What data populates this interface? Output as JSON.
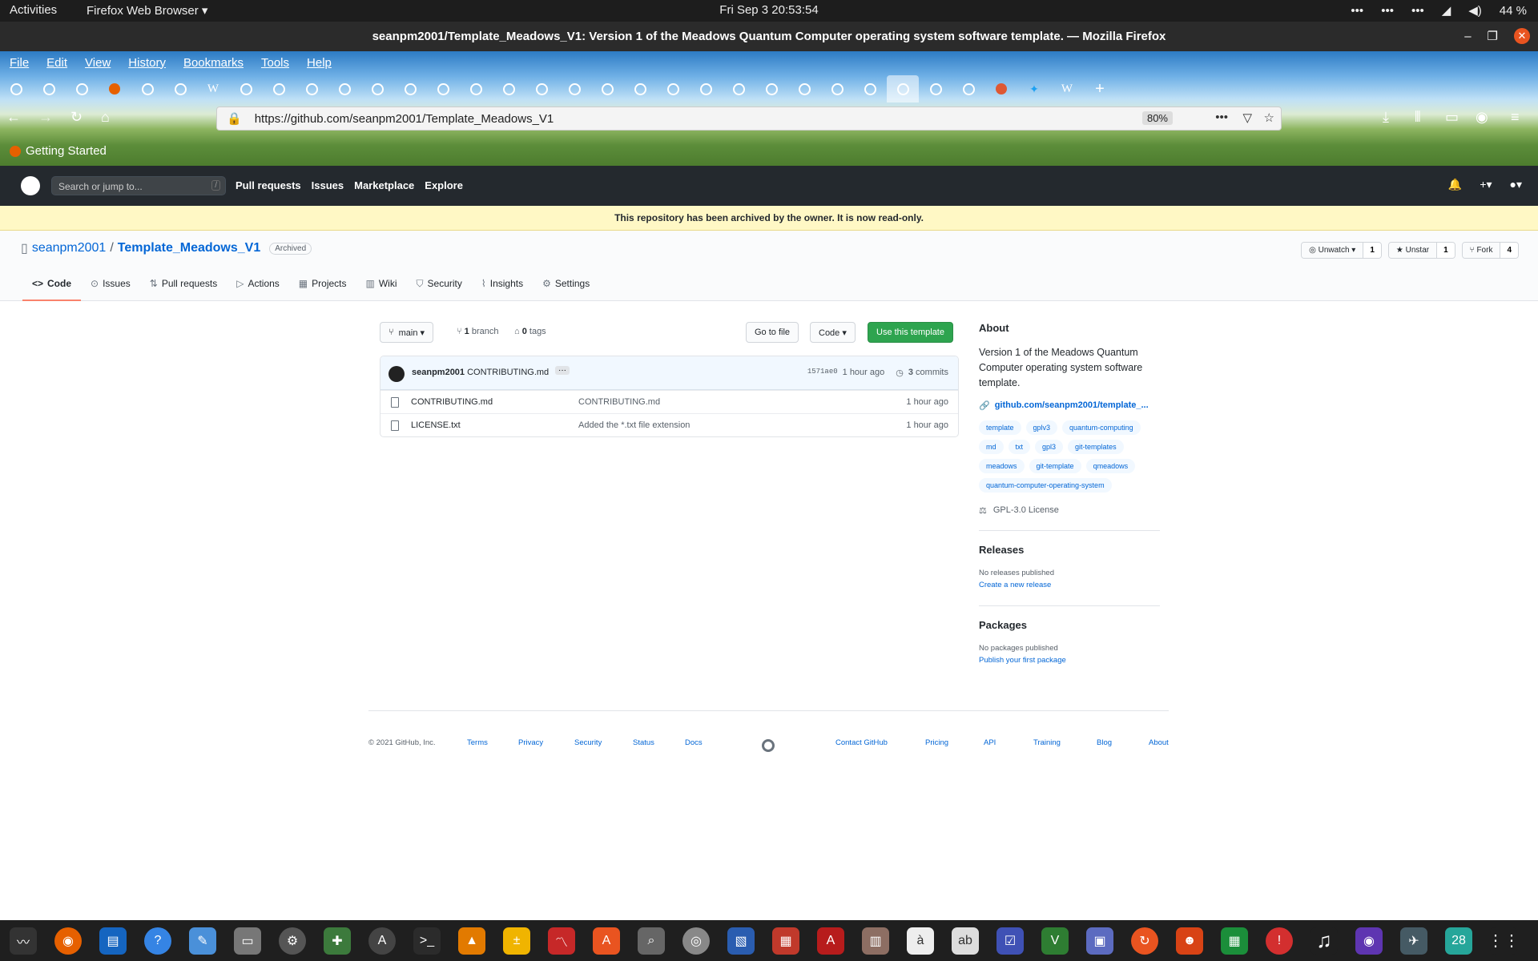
{
  "system": {
    "activities": "Activities",
    "app_menu": "Firefox Web Browser ▾",
    "clock": "Fri Sep 3  20:53:54",
    "battery": "44 %"
  },
  "window": {
    "title": "seanpm2001/Template_Meadows_V1: Version 1 of the Meadows Quantum Computer operating system software template. — Mozilla Firefox"
  },
  "menubar": [
    "File",
    "Edit",
    "View",
    "History",
    "Bookmarks",
    "Tools",
    "Help"
  ],
  "address": {
    "url_pre": "https://github.com/",
    "url_path": "seanpm2001/Template_Meadows_V1",
    "zoom": "80%"
  },
  "bookmarks": {
    "getting_started": "Getting Started"
  },
  "github": {
    "search_placeholder": "Search or jump to...",
    "slash": "/",
    "nav": [
      "Pull requests",
      "Issues",
      "Marketplace",
      "Explore"
    ]
  },
  "archived_banner": "This repository has been archived by the owner. It is now read-only.",
  "repo": {
    "owner": "seanpm2001",
    "sep": "/",
    "name": "Template_Meadows_V1",
    "badge": "Archived",
    "watch": {
      "label": "Unwatch ▾",
      "count": "1"
    },
    "star": {
      "label": "Unstar",
      "count": "1"
    },
    "fork": {
      "label": "Fork",
      "count": "4"
    },
    "tabs": [
      "Code",
      "Issues",
      "Pull requests",
      "Actions",
      "Projects",
      "Wiki",
      "Security",
      "Insights",
      "Settings"
    ]
  },
  "toolbar": {
    "branch": "main ▾",
    "branches_count": "1",
    "branches_label": "branch",
    "tags_count": "0",
    "tags_label": "tags",
    "go_to_file": "Go to file",
    "code": "Code ▾",
    "use_template": "Use this template"
  },
  "commit": {
    "author": "seanpm2001",
    "message": "CONTRIBUTING.md",
    "dots": "···",
    "sha": "1571ae0",
    "time": "1 hour ago",
    "commits_count": "3",
    "commits_label": "commits"
  },
  "files": [
    {
      "name": "CONTRIBUTING.md",
      "message": "CONTRIBUTING.md",
      "time": "1 hour ago"
    },
    {
      "name": "LICENSE.txt",
      "message": "Added the *.txt file extension",
      "time": "1 hour ago"
    }
  ],
  "about": {
    "heading": "About",
    "description": "Version 1 of the Meadows Quantum Computer operating system software template.",
    "link": "github.com/seanpm2001/template_...",
    "topics": [
      "template",
      "gplv3",
      "quantum-computing",
      "md",
      "txt",
      "gpl3",
      "git-templates",
      "meadows",
      "git-template",
      "qmeadows",
      "quantum-computer-operating-system"
    ],
    "license": "GPL-3.0 License"
  },
  "releases": {
    "heading": "Releases",
    "none": "No releases published",
    "create": "Create a new release"
  },
  "packages": {
    "heading": "Packages",
    "none": "No packages published",
    "publish": "Publish your first package"
  },
  "footer": {
    "copyright": "© 2021 GitHub, Inc.",
    "left": [
      "Terms",
      "Privacy",
      "Security",
      "Status",
      "Docs"
    ],
    "right": [
      "Contact GitHub",
      "Pricing",
      "API",
      "Training",
      "Blog",
      "About"
    ]
  },
  "dock_badge": "28"
}
